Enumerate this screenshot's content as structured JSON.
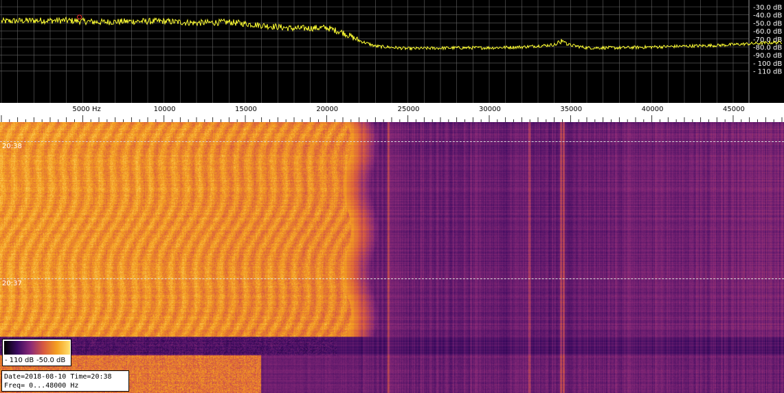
{
  "spectrum": {
    "db_labels": [
      "-30.0 dB",
      "-40.0 dB",
      "-50.0 dB",
      "-60.0 dB",
      "-70.0 dB",
      "-80.0 dB",
      "-90.0 dB",
      "- 100 dB",
      "- 110 dB"
    ],
    "db_range": [
      -30,
      -110
    ],
    "trace_color": "#ffff33",
    "grid_color": "#666666"
  },
  "chart_data": {
    "type": "line",
    "xlabel": "",
    "ylabel": "",
    "xlim": [
      0,
      48000
    ],
    "ylim": [
      -110,
      -30
    ],
    "x": [
      0,
      2000,
      4000,
      6000,
      8000,
      10000,
      12000,
      14000,
      16000,
      18000,
      20000,
      21000,
      22000,
      23000,
      25000,
      28000,
      30000,
      32000,
      33500,
      34500,
      36000,
      38000,
      40000,
      42000,
      44000,
      46000,
      48000
    ],
    "series": [
      {
        "values": [
          -48,
          -47,
          -47,
          -49,
          -48,
          -48,
          -50,
          -49,
          -53,
          -57,
          -56,
          -62,
          -72,
          -79,
          -82,
          -81,
          -81,
          -80,
          -78,
          -76,
          -81,
          -81,
          -80,
          -79,
          -78,
          -76,
          -74
        ]
      }
    ]
  },
  "freq_axis": {
    "tick_labels": [
      {
        "hz": 5000,
        "label": "5000 Hz"
      },
      {
        "hz": 10000,
        "label": "10000"
      },
      {
        "hz": 15000,
        "label": "15000"
      },
      {
        "hz": 20000,
        "label": "20000"
      },
      {
        "hz": 25000,
        "label": "25000"
      },
      {
        "hz": 30000,
        "label": "30000"
      },
      {
        "hz": 35000,
        "label": "35000"
      },
      {
        "hz": 40000,
        "label": "40000"
      },
      {
        "hz": 45000,
        "label": "45000"
      }
    ]
  },
  "waterfall": {
    "time_marks": [
      "20:38",
      "20:37"
    ]
  },
  "colorbar": {
    "min_label": "- 110 dB",
    "max_label": "-50.0 dB",
    "stops": [
      "#000000",
      "#3a0a60",
      "#8a2a78",
      "#d85a40",
      "#f5a020",
      "#ffe070"
    ]
  },
  "info": {
    "date_line": "Date=2018-08-10 Time=20:38",
    "freq_line": "Freq= 0...48000 Hz"
  }
}
